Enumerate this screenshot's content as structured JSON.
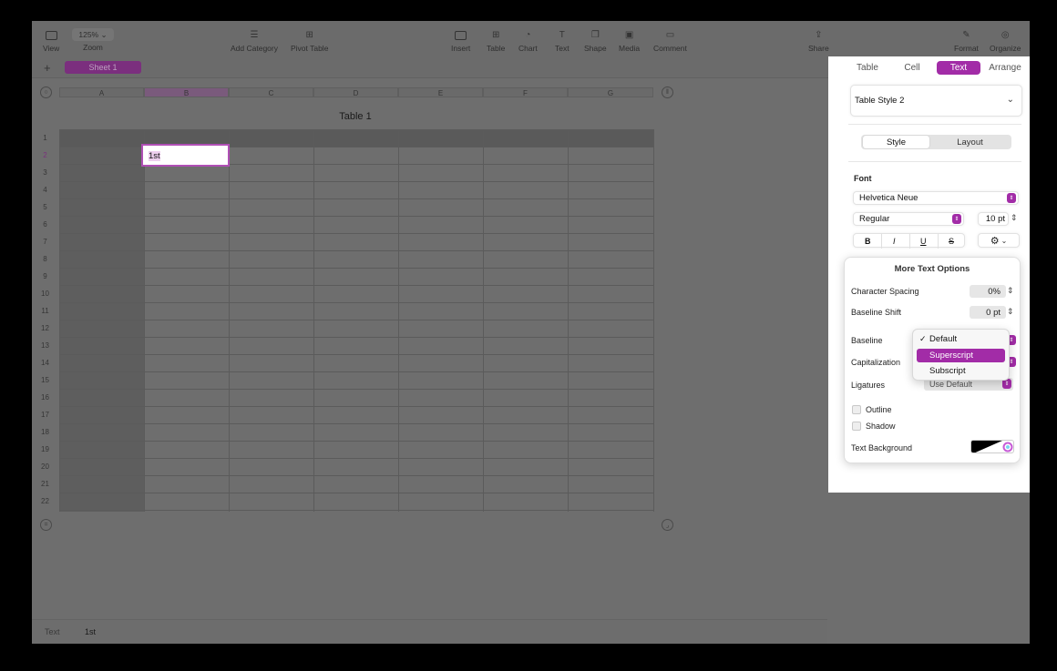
{
  "toolbar": {
    "view": "View",
    "zoom_value": "125%",
    "zoom": "Zoom",
    "add_category": "Add Category",
    "pivot_table": "Pivot Table",
    "insert": "Insert",
    "table": "Table",
    "chart": "Chart",
    "text": "Text",
    "shape": "Shape",
    "media": "Media",
    "comment": "Comment",
    "share": "Share",
    "format": "Format",
    "organize": "Organize"
  },
  "sheet": {
    "add": "+",
    "tab": "Sheet 1"
  },
  "table": {
    "title": "Table 1",
    "columns": [
      "A",
      "B",
      "C",
      "D",
      "E",
      "F",
      "G"
    ],
    "rows": [
      "1",
      "2",
      "3",
      "4",
      "5",
      "6",
      "7",
      "8",
      "9",
      "10",
      "11",
      "12",
      "13",
      "14",
      "15",
      "16",
      "17",
      "18",
      "19",
      "20",
      "21",
      "22"
    ],
    "selected_cell_text": "1st"
  },
  "status": {
    "label": "Text",
    "value": "1st"
  },
  "panel": {
    "tabs": [
      "Table",
      "Cell",
      "Text",
      "Arrange"
    ],
    "active_tab": "Text",
    "table_style": "Table Style 2",
    "segments": [
      "Style",
      "Layout"
    ],
    "font_heading": "Font",
    "font_family": "Helvetica Neue",
    "font_style": "Regular",
    "font_size": "10 pt",
    "bold": "B",
    "italic": "I",
    "underline": "U",
    "strike": "S"
  },
  "more_text": {
    "title": "More Text Options",
    "char_spacing_label": "Character Spacing",
    "char_spacing_value": "0%",
    "baseline_shift_label": "Baseline Shift",
    "baseline_shift_value": "0 pt",
    "baseline_label": "Baseline",
    "capitalization_label": "Capitalization",
    "ligatures_label": "Ligatures",
    "ligatures_value": "Use Default",
    "outline_label": "Outline",
    "shadow_label": "Shadow",
    "text_bg_label": "Text Background"
  },
  "baseline_menu": {
    "check": "✓",
    "items": [
      "Default",
      "Superscript",
      "Subscript"
    ],
    "selected": "Default",
    "highlighted": "Superscript"
  },
  "colors": {
    "accent": "#a22ca7",
    "sheet_tab": "#7b2f7e"
  }
}
